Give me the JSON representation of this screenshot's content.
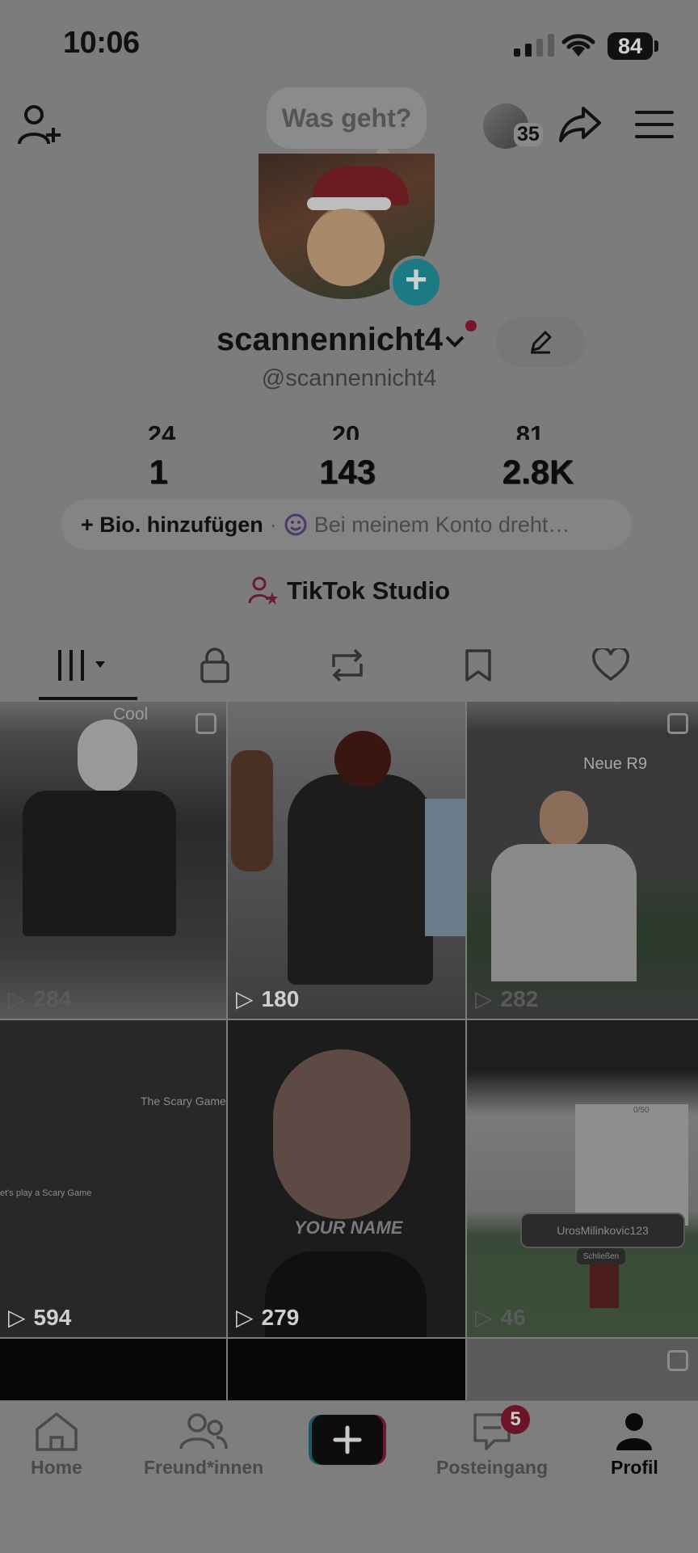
{
  "status_bar": {
    "time": "10:06",
    "battery": "84"
  },
  "header": {
    "bubble_text": "Was geht?",
    "story_count": "35"
  },
  "profile": {
    "display_name": "scannennicht4",
    "handle": "@scannennicht4"
  },
  "stats": {
    "ghost": [
      "24",
      "20",
      "81"
    ],
    "values": [
      "1",
      "143",
      "2.8K"
    ]
  },
  "bio": {
    "add_label": "+ Bio. hinzufügen",
    "separator": "·",
    "hint": "Bei meinem Konto dreht…"
  },
  "studio_label": "TikTok Studio",
  "tabs": [
    "videos",
    "private",
    "reposts",
    "favorites",
    "liked"
  ],
  "videos": [
    {
      "views": "284",
      "overlay": "Cool"
    },
    {
      "views": "180"
    },
    {
      "views": "282",
      "overlay": "Neue R9"
    },
    {
      "views": "594",
      "overlay": "The Scary Game",
      "overlay2": "et's play a Scary Game"
    },
    {
      "views": "279",
      "overlay": "YOUR NAME"
    },
    {
      "views": "46",
      "overlay": "UrosMilinkovic123",
      "overlay2": "Schließen",
      "overlay3": "0/50"
    }
  ],
  "bottom_nav": {
    "home": "Home",
    "friends": "Freund*innen",
    "inbox": "Posteingang",
    "inbox_badge": "5",
    "profile": "Profil"
  }
}
